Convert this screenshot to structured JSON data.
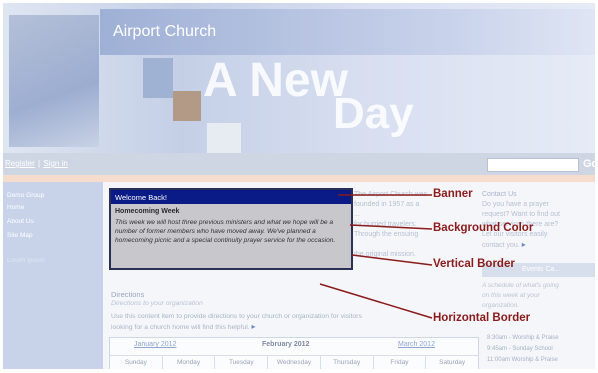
{
  "site": {
    "title": "Airport Church",
    "slogan_line1": "A New",
    "slogan_line2": "Day"
  },
  "topbar": {
    "link_register": "Register",
    "separator": "|",
    "link_signin": "Sign in",
    "search_value": "",
    "go_label": "Go"
  },
  "sidebar": {
    "items": [
      "Demo Group",
      "Home",
      "About Us",
      "Site Map",
      "Lorem Ipsum"
    ]
  },
  "welcome": {
    "heading": "Welcome Back!",
    "subtitle": "Homecoming Week",
    "body": "This week we will host three previous ministers and what we hope will be a number of former members who have moved away. We've planned a homecoming picnic and a special continuity prayer service for the occasion."
  },
  "history": {
    "line1": "The Airport Church was",
    "line2": "founded in 1957 as a",
    "line3": "...",
    "line4": "for hurried travelers.",
    "line5": "Through the ensuing",
    "line6": "the original mission."
  },
  "contact": {
    "heading": "Contact Us",
    "line1": "Do you have a prayer",
    "line2": "request? Want to find out",
    "line3": "what services there are?",
    "line4": "Let our visitors easily",
    "line5": "contact you."
  },
  "events": {
    "box_title": "Events Ca...",
    "desc1": "A schedule of what's going",
    "desc2": "on this week at your",
    "desc3": "organization.",
    "times": [
      "8:30am - Worship & Praise",
      "9:45am - Sunday School",
      "11:00am Worship & Praise"
    ]
  },
  "directions": {
    "title": "Directions",
    "subtitle": "Directions to your organization",
    "body1": "Use this content item to provide directions to your church or organization for visitors",
    "body2": "looking for a church home will find this helpful."
  },
  "calendar": {
    "prev": "January 2012",
    "current": "February 2012",
    "next": "March 2012",
    "days": [
      "Sunday",
      "Monday",
      "Tuesday",
      "Wednesday",
      "Thursday",
      "Friday",
      "Saturday"
    ]
  },
  "callouts": {
    "banner": "Banner",
    "background_color": "Background Color",
    "vertical_border": "Vertical Border",
    "horizontal_border": "Horizontal Border"
  },
  "colors": {
    "banner_blue": "#0a1a86",
    "callout_red": "#8b1a1a",
    "panel_gray": "#c7c7cc"
  }
}
